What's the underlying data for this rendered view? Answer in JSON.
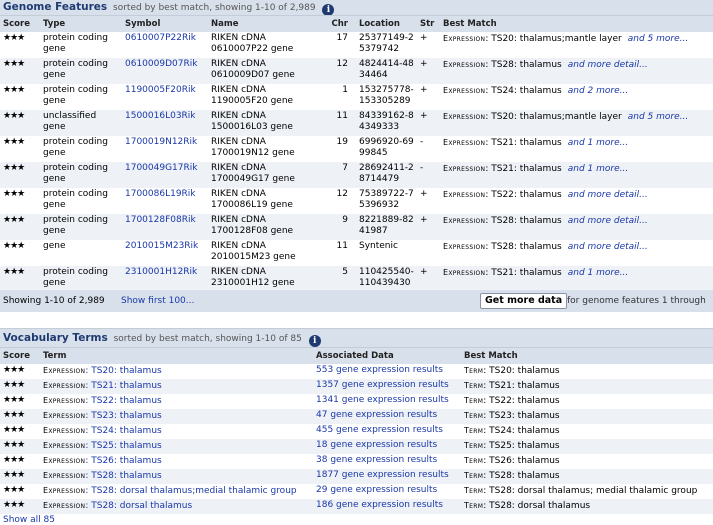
{
  "genome": {
    "title": "Genome Features",
    "subtitle": "sorted by best match, showing 1-10 of 2,989",
    "columns": [
      "Score",
      "Type",
      "Symbol",
      "Name",
      "Chr",
      "Location",
      "Str",
      "Best Match"
    ],
    "rows": [
      {
        "score": "★★★",
        "type": "protein coding gene",
        "symbol": "0610007P22Rik",
        "name": "RIKEN cDNA 0610007P22 gene",
        "chr": "17",
        "loc": "25377149-25379742",
        "str": "+",
        "match_prefix": "Expression",
        "match": ": TS20: thalamus;mantle layer",
        "more": "and 5 more..."
      },
      {
        "score": "★★★",
        "type": "protein coding gene",
        "symbol": "0610009D07Rik",
        "name": "RIKEN cDNA 0610009D07 gene",
        "chr": "12",
        "loc": "4824414-4834464",
        "str": "+",
        "match_prefix": "Expression",
        "match": ": TS28: thalamus",
        "more": "and more detail..."
      },
      {
        "score": "★★★",
        "type": "protein coding gene",
        "symbol": "1190005F20Rik",
        "name": "RIKEN cDNA 1190005F20 gene",
        "chr": "1",
        "loc": "153275778-153305289",
        "str": "+",
        "match_prefix": "Expression",
        "match": ": TS24: thalamus",
        "more": "and 2 more..."
      },
      {
        "score": "★★★",
        "type": "unclassified gene",
        "symbol": "1500016L03Rik",
        "name": "RIKEN cDNA 1500016L03 gene",
        "chr": "11",
        "loc": "84339162-84349333",
        "str": "+",
        "match_prefix": "Expression",
        "match": ": TS20: thalamus;mantle layer",
        "more": "and 5 more..."
      },
      {
        "score": "★★★",
        "type": "protein coding gene",
        "symbol": "1700019N12Rik",
        "name": "RIKEN cDNA 1700019N12 gene",
        "chr": "19",
        "loc": "6996920-6999845",
        "str": "-",
        "match_prefix": "Expression",
        "match": ": TS21: thalamus",
        "more": "and 1 more..."
      },
      {
        "score": "★★★",
        "type": "protein coding gene",
        "symbol": "1700049G17Rik",
        "name": "RIKEN cDNA 1700049G17 gene",
        "chr": "7",
        "loc": "28692411-28714479",
        "str": "-",
        "match_prefix": "Expression",
        "match": ": TS21: thalamus",
        "more": "and 1 more..."
      },
      {
        "score": "★★★",
        "type": "protein coding gene",
        "symbol": "1700086L19Rik",
        "name": "RIKEN cDNA 1700086L19 gene",
        "chr": "12",
        "loc": "75389722-75396932",
        "str": "+",
        "match_prefix": "Expression",
        "match": ": TS22: thalamus",
        "more": "and more detail..."
      },
      {
        "score": "★★★",
        "type": "protein coding gene",
        "symbol": "1700128F08Rik",
        "name": "RIKEN cDNA 1700128F08 gene",
        "chr": "9",
        "loc": "8221889-8241987",
        "str": "+",
        "match_prefix": "Expression",
        "match": ": TS28: thalamus",
        "more": "and more detail..."
      },
      {
        "score": "★★★",
        "type": "gene",
        "symbol": "2010015M23Rik",
        "name": "RIKEN cDNA 2010015M23 gene",
        "chr": "11",
        "loc": "Syntenic",
        "str": "",
        "match_prefix": "Expression",
        "match": ": TS28: thalamus",
        "more": "and more detail..."
      },
      {
        "score": "★★★",
        "type": "protein coding gene",
        "symbol": "2310001H12Rik",
        "name": "RIKEN cDNA 2310001H12 gene",
        "chr": "5",
        "loc": "110425540-110439430",
        "str": "+",
        "match_prefix": "Expression",
        "match": ": TS21: thalamus",
        "more": "and 1 more..."
      }
    ],
    "footer": {
      "showing": "Showing 1-10 of 2,989",
      "show_first": "Show first 100...",
      "button": "Get more data",
      "trail": "for genome features 1 through"
    }
  },
  "vocab": {
    "title": "Vocabulary Terms",
    "subtitle": "sorted by best match, showing 1-10 of 85",
    "columns": [
      "Score",
      "Term",
      "Associated Data",
      "Best Match"
    ],
    "rows": [
      {
        "score": "★★★",
        "prefix": "Expression",
        "term": ": TS20: thalamus",
        "data": "553 gene expression results",
        "match_prefix": "Term",
        "match": ": TS20: thalamus"
      },
      {
        "score": "★★★",
        "prefix": "Expression",
        "term": ": TS21: thalamus",
        "data": "1357 gene expression results",
        "match_prefix": "Term",
        "match": ": TS21: thalamus"
      },
      {
        "score": "★★★",
        "prefix": "Expression",
        "term": ": TS22: thalamus",
        "data": "1341 gene expression results",
        "match_prefix": "Term",
        "match": ": TS22: thalamus"
      },
      {
        "score": "★★★",
        "prefix": "Expression",
        "term": ": TS23: thalamus",
        "data": "47 gene expression results",
        "match_prefix": "Term",
        "match": ": TS23: thalamus"
      },
      {
        "score": "★★★",
        "prefix": "Expression",
        "term": ": TS24: thalamus",
        "data": "455 gene expression results",
        "match_prefix": "Term",
        "match": ": TS24: thalamus"
      },
      {
        "score": "★★★",
        "prefix": "Expression",
        "term": ": TS25: thalamus",
        "data": "18 gene expression results",
        "match_prefix": "Term",
        "match": ": TS25: thalamus"
      },
      {
        "score": "★★★",
        "prefix": "Expression",
        "term": ": TS26: thalamus",
        "data": "38 gene expression results",
        "match_prefix": "Term",
        "match": ": TS26: thalamus"
      },
      {
        "score": "★★★",
        "prefix": "Expression",
        "term": ": TS28: thalamus",
        "data": "1877 gene expression results",
        "match_prefix": "Term",
        "match": ": TS28: thalamus"
      },
      {
        "score": "★★★",
        "prefix": "Expression",
        "term": ": TS28: dorsal thalamus;medial thalamic group",
        "data": "29 gene expression results",
        "match_prefix": "Term",
        "match": ": TS28: dorsal thalamus; medial thalamic group"
      },
      {
        "score": "★★★",
        "prefix": "Expression",
        "term": ": TS28: dorsal thalamus",
        "data": "186 gene expression results",
        "match_prefix": "Term",
        "match": ": TS28: dorsal thalamus"
      }
    ],
    "footer_partial": "Show all 85"
  },
  "icons": {
    "info": "i"
  }
}
